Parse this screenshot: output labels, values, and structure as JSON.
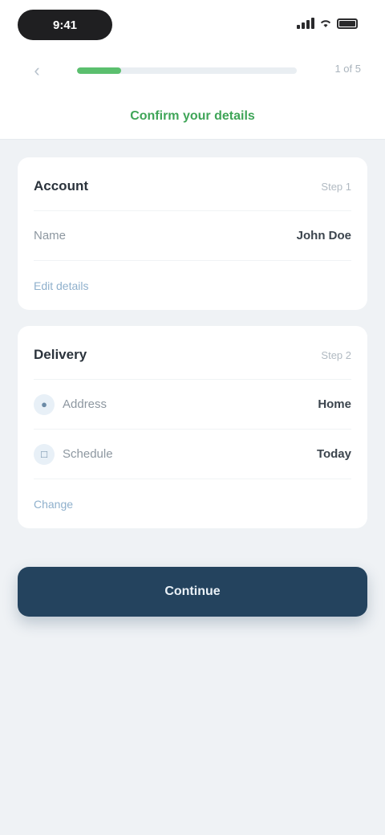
{
  "status_bar": {
    "time": "9:41"
  },
  "nav": {
    "back_icon": "chevron-left-icon",
    "progress_percent": 20,
    "step_label": "1 of 5",
    "title": "Confirm your details"
  },
  "card_account": {
    "title": "Account",
    "meta": "Step 1",
    "rows": [
      {
        "label": "Name",
        "value": "John Doe"
      }
    ],
    "link": "Edit details"
  },
  "card_delivery": {
    "title": "Delivery",
    "meta": "Step 2",
    "rows": [
      {
        "icon": "location-icon",
        "label": "Address",
        "value": "Home"
      },
      {
        "icon": "calendar-icon",
        "label": "Schedule",
        "value": "Today"
      }
    ],
    "link": "Change"
  },
  "cta": {
    "label": "Continue"
  },
  "colors": {
    "accent_green": "#5bbf6e",
    "primary_button": "#24435e",
    "link_blue": "#8fb0cc"
  }
}
